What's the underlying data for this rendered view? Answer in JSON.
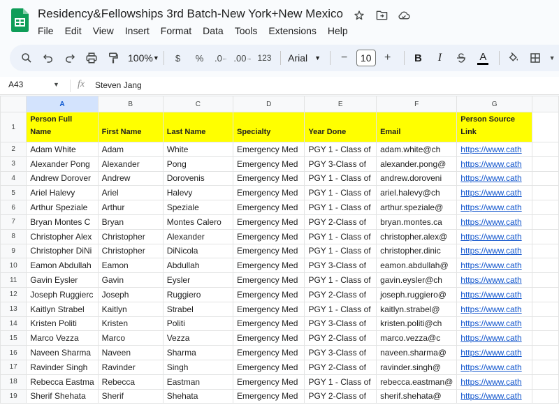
{
  "app": {
    "title": "Residency&Fellowships 3rd Batch-New York+New Mexico",
    "menu": [
      "File",
      "Edit",
      "View",
      "Insert",
      "Format",
      "Data",
      "Tools",
      "Extensions",
      "Help"
    ]
  },
  "toolbar": {
    "zoom": "100%",
    "currency": "$",
    "percent": "%",
    "decimal_decrease": ".0",
    "decimal_increase": ".00",
    "format_more": "123",
    "font": "Arial",
    "font_size": "10",
    "minus": "−",
    "plus": "+",
    "bold": "B",
    "italic": "I",
    "text_color": "A"
  },
  "formula_bar": {
    "cell_ref": "A43",
    "fx": "fx",
    "value": "Steven Jang"
  },
  "sheet": {
    "columns": [
      "A",
      "B",
      "C",
      "D",
      "E",
      "F",
      "G"
    ],
    "header_row_number": "1",
    "headers": [
      "Person Full Name",
      "First Name",
      "Last Name",
      "Specialty",
      "Year Done",
      "Email",
      "Person Source Link"
    ],
    "rows": [
      {
        "n": "2",
        "cells": [
          "Adam White",
          "Adam",
          "White",
          "Emergency Med",
          "PGY 1 - Class of",
          "adam.white@ch",
          "https://www.cath"
        ]
      },
      {
        "n": "3",
        "cells": [
          "Alexander Pong",
          "Alexander",
          "Pong",
          "Emergency Med",
          "PGY 3-Class of",
          "alexander.pong@",
          "https://www.cath"
        ]
      },
      {
        "n": "4",
        "cells": [
          "Andrew Dorover",
          "Andrew",
          "Dorovenis",
          "Emergency Med",
          "PGY 1 - Class of",
          "andrew.doroveni",
          "https://www.cath"
        ]
      },
      {
        "n": "5",
        "cells": [
          "Ariel Halevy",
          "Ariel",
          "Halevy",
          "Emergency Med",
          "PGY 1 - Class of",
          "ariel.halevy@ch",
          "https://www.cath"
        ]
      },
      {
        "n": "6",
        "cells": [
          "Arthur Speziale",
          "Arthur",
          "Speziale",
          "Emergency Med",
          "PGY 1 - Class of",
          "arthur.speziale@",
          "https://www.cath"
        ]
      },
      {
        "n": "7",
        "cells": [
          "Bryan Montes C",
          "Bryan",
          "Montes Calero",
          "Emergency Med",
          "PGY 2-Class of",
          "bryan.montes.ca",
          "https://www.cath"
        ]
      },
      {
        "n": "8",
        "cells": [
          "Christopher Alex",
          "Christopher",
          "Alexander",
          "Emergency Med",
          "PGY 1 - Class of",
          "christopher.alex@",
          "https://www.cath"
        ]
      },
      {
        "n": "9",
        "cells": [
          "Christopher DiNi",
          "Christopher",
          "DiNicola",
          "Emergency Med",
          "PGY 1 - Class of",
          "christopher.dinic",
          "https://www.cath"
        ]
      },
      {
        "n": "10",
        "cells": [
          "Eamon Abdullah",
          "Eamon",
          "Abdullah",
          "Emergency Med",
          "PGY 3-Class of",
          "eamon.abdullah@",
          "https://www.cath"
        ]
      },
      {
        "n": "11",
        "cells": [
          "Gavin Eysler",
          "Gavin",
          "Eysler",
          "Emergency Med",
          "PGY 1 - Class of",
          "gavin.eysler@ch",
          "https://www.cath"
        ]
      },
      {
        "n": "12",
        "cells": [
          "Joseph Ruggierc",
          "Joseph",
          "Ruggiero",
          "Emergency Med",
          "PGY 2-Class of",
          "joseph.ruggiero@",
          "https://www.cath"
        ]
      },
      {
        "n": "13",
        "cells": [
          "Kaitlyn Strabel",
          "Kaitlyn",
          "Strabel",
          "Emergency Med",
          "PGY 1 - Class of",
          "kaitlyn.strabel@",
          "https://www.cath"
        ]
      },
      {
        "n": "14",
        "cells": [
          "Kristen Politi",
          "Kristen",
          "Politi",
          "Emergency Med",
          "PGY 3-Class of",
          "kristen.politi@ch",
          "https://www.cath"
        ]
      },
      {
        "n": "15",
        "cells": [
          "Marco Vezza",
          "Marco",
          "Vezza",
          "Emergency Med",
          "PGY 2-Class of",
          "marco.vezza@c",
          "https://www.cath"
        ]
      },
      {
        "n": "16",
        "cells": [
          "Naveen Sharma",
          "Naveen",
          "Sharma",
          "Emergency Med",
          "PGY 3-Class of",
          "naveen.sharma@",
          "https://www.cath"
        ]
      },
      {
        "n": "17",
        "cells": [
          "Ravinder Singh",
          "Ravinder",
          "Singh",
          "Emergency Med",
          "PGY 2-Class of",
          "ravinder.singh@",
          "https://www.cath"
        ]
      },
      {
        "n": "18",
        "cells": [
          "Rebecca Eastma",
          "Rebecca",
          "Eastman",
          "Emergency Med",
          "PGY 1 - Class of",
          "rebecca.eastman@",
          "https://www.cath"
        ]
      },
      {
        "n": "19",
        "cells": [
          "Sherif Shehata",
          "Sherif",
          "Shehata",
          "Emergency Med",
          "PGY 2-Class of",
          "sherif.shehata@",
          "https://www.cath"
        ]
      }
    ]
  },
  "colors": {
    "header_fill": "#ffff00",
    "link": "#1155cc",
    "selected_column": "#d3e3fd",
    "logo_green": "#0f9d58"
  },
  "icons": [
    "sheets-logo-icon",
    "star-icon",
    "move-folder-icon",
    "cloud-status-icon",
    "search-icon",
    "undo-icon",
    "redo-icon",
    "print-icon",
    "paint-format-icon",
    "fill-color-icon",
    "borders-icon"
  ]
}
